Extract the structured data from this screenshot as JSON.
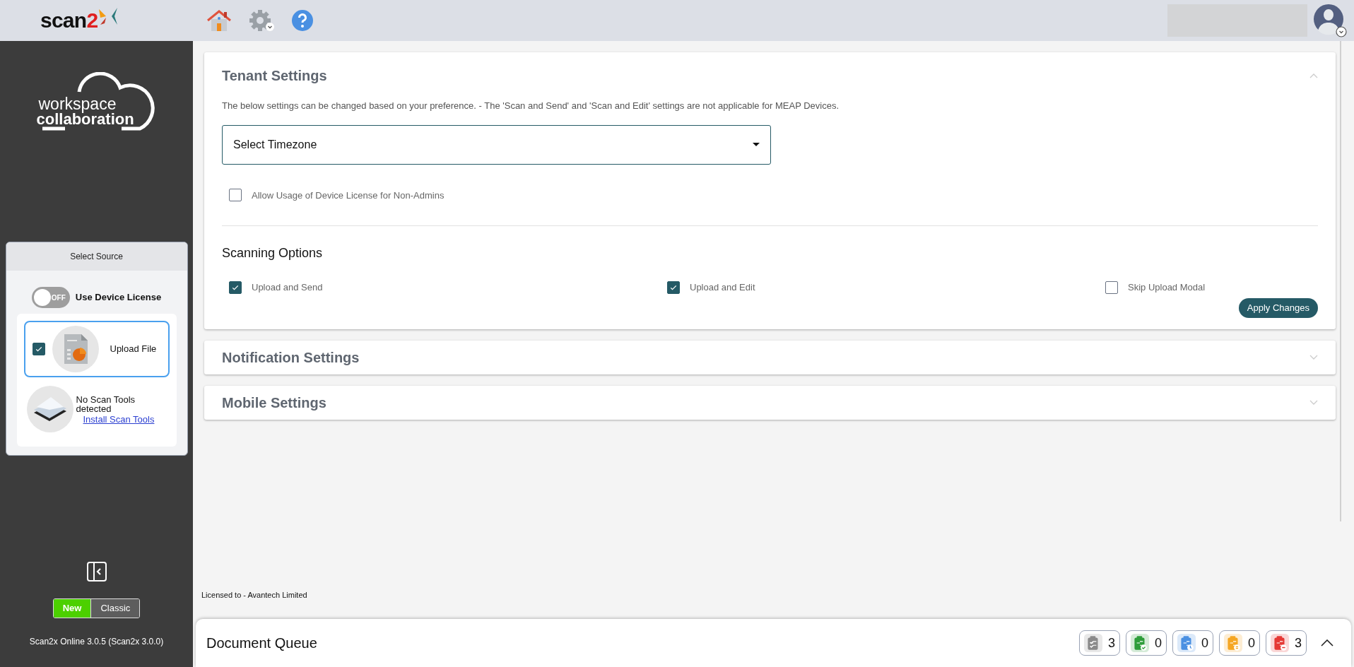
{
  "header": {
    "logo": {
      "text": "scan",
      "accent": "2"
    }
  },
  "sidebar": {
    "brand": {
      "line1": "workspace",
      "line2": "collaboration"
    },
    "source_panel": {
      "title": "Select Source",
      "toggle": {
        "on": false,
        "state_text": "OFF",
        "label": "Use Device License"
      },
      "sources": [
        {
          "kind": "file",
          "label": "Upload File",
          "checked": true,
          "selected": true
        },
        {
          "kind": "scanner",
          "message": "No Scan Tools detected",
          "link": "Install Scan Tools"
        }
      ]
    },
    "mode_switch": [
      {
        "label": "New",
        "selected": true
      },
      {
        "label": "Classic",
        "selected": false
      }
    ],
    "version": "Scan2x Online 3.0.5 (Scan2x 3.0.0)"
  },
  "sections": [
    {
      "title": "Tenant Settings",
      "expanded": true,
      "description": "The below settings can be changed based on your preference. - The 'Scan and Send' and 'Scan and Edit' settings are not applicable for MEAP Devices.",
      "timezone": {
        "placeholder": "Select Timezone"
      },
      "license_option": {
        "label": "Allow Usage of Device License for Non-Admins",
        "checked": false
      },
      "scanning_title": "Scanning Options",
      "scanning_options": [
        {
          "label": "Upload and Send",
          "checked": true
        },
        {
          "label": "Upload and Edit",
          "checked": true
        },
        {
          "label": "Skip Upload Modal",
          "checked": false
        }
      ],
      "apply_button": "Apply Changes"
    },
    {
      "title": "Notification Settings",
      "expanded": false
    },
    {
      "title": "Mobile Settings",
      "expanded": false
    }
  ],
  "license_note": "Licensed to - Avantech Limited",
  "document_queue": {
    "title": "Document Queue",
    "counters": [
      {
        "kind": "all",
        "count": "3",
        "color": "#8a8a8a"
      },
      {
        "kind": "done",
        "count": "0",
        "color": "#2e9d3a"
      },
      {
        "kind": "processing",
        "count": "0",
        "color": "#4a90e2"
      },
      {
        "kind": "pending",
        "count": "0",
        "color": "#f5a623"
      },
      {
        "kind": "failed",
        "count": "3",
        "color": "#e53935"
      }
    ]
  }
}
